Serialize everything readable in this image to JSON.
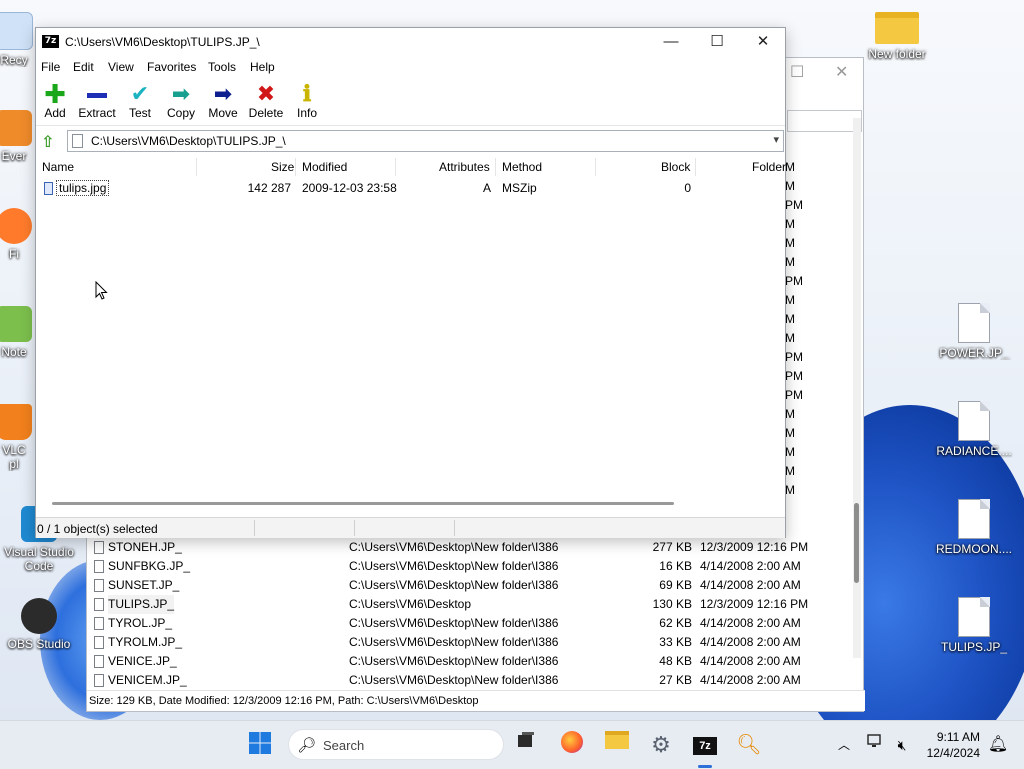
{
  "desktop": {
    "right_icons": [
      {
        "label": "New folder",
        "kind": "folder"
      },
      {
        "label": "POWER.JP_",
        "kind": "file"
      },
      {
        "label": "RADIANCE....",
        "kind": "file"
      },
      {
        "label": "REDMOON....",
        "kind": "file"
      },
      {
        "label": "TULIPS.JP_",
        "kind": "file"
      }
    ],
    "left_icons": [
      {
        "label": "Recy"
      },
      {
        "label": "Ever"
      },
      {
        "label": "Fi"
      },
      {
        "label": "Note"
      },
      {
        "label": "VLC\npl"
      },
      {
        "label": "Visual Studio Code"
      },
      {
        "label": "OBS Studio"
      }
    ]
  },
  "explorer": {
    "right_column": [
      "M",
      "M",
      "PM",
      "M",
      "M",
      "M",
      "PM",
      "M",
      "M",
      "M",
      "PM",
      "PM",
      "PM",
      "M",
      "M",
      "M",
      "M",
      "M"
    ],
    "rows": [
      {
        "name": "STONEH.JP_",
        "path": "C:\\Users\\VM6\\Desktop\\New folder\\I386",
        "size": "277 KB",
        "date": "12/3/2009 12:16 PM"
      },
      {
        "name": "SUNFBKG.JP_",
        "path": "C:\\Users\\VM6\\Desktop\\New folder\\I386",
        "size": "16 KB",
        "date": "4/14/2008 2:00 AM"
      },
      {
        "name": "SUNSET.JP_",
        "path": "C:\\Users\\VM6\\Desktop\\New folder\\I386",
        "size": "69 KB",
        "date": "4/14/2008 2:00 AM"
      },
      {
        "name": "TULIPS.JP_",
        "path": "C:\\Users\\VM6\\Desktop",
        "size": "130 KB",
        "date": "12/3/2009 12:16 PM"
      },
      {
        "name": "TYROL.JP_",
        "path": "C:\\Users\\VM6\\Desktop\\New folder\\I386",
        "size": "62 KB",
        "date": "4/14/2008 2:00 AM"
      },
      {
        "name": "TYROLM.JP_",
        "path": "C:\\Users\\VM6\\Desktop\\New folder\\I386",
        "size": "33 KB",
        "date": "4/14/2008 2:00 AM"
      },
      {
        "name": "VENICE.JP_",
        "path": "C:\\Users\\VM6\\Desktop\\New folder\\I386",
        "size": "48 KB",
        "date": "4/14/2008 2:00 AM"
      },
      {
        "name": "VENICEM.JP_",
        "path": "C:\\Users\\VM6\\Desktop\\New folder\\I386",
        "size": "27 KB",
        "date": "4/14/2008 2:00 AM"
      }
    ],
    "status": "Size: 129 KB, Date Modified: 12/3/2009 12:16 PM, Path: C:\\Users\\VM6\\Desktop"
  },
  "sevenzip": {
    "logo": "7z",
    "title": "C:\\Users\\VM6\\Desktop\\TULIPS.JP_\\",
    "window_buttons": {
      "minimize": "—",
      "maximize": "☐",
      "close": "✕"
    },
    "menu": [
      "File",
      "Edit",
      "View",
      "Favorites",
      "Tools",
      "Help"
    ],
    "toolbar": [
      {
        "label": "Add",
        "icon": "plus-icon",
        "color": "#1aa81a"
      },
      {
        "label": "Extract",
        "icon": "minus-icon",
        "color": "#1f2fb5"
      },
      {
        "label": "Test",
        "icon": "check-icon",
        "color": "#1bb3c0"
      },
      {
        "label": "Copy",
        "icon": "copy-arrow-icon",
        "color": "#17a090"
      },
      {
        "label": "Move",
        "icon": "move-arrow-icon",
        "color": "#0d1f8f"
      },
      {
        "label": "Delete",
        "icon": "delete-x-icon",
        "color": "#d01818"
      },
      {
        "label": "Info",
        "icon": "info-icon",
        "color": "#c9b400"
      }
    ],
    "address": "C:\\Users\\VM6\\Desktop\\TULIPS.JP_\\",
    "columns": [
      "Name",
      "Size",
      "Modified",
      "Attributes",
      "Method",
      "Block",
      "Folders"
    ],
    "columns_visible": [
      "Name",
      "Size",
      "Modified",
      "Attributes",
      "Method",
      "Block",
      "Folder"
    ],
    "files": [
      {
        "name": "tulips.jpg",
        "size": "142 287",
        "modified": "2009-12-03 23:58",
        "attributes": "A",
        "method": "MSZip",
        "block": "0"
      }
    ],
    "status": "0 / 1 object(s) selected"
  },
  "taskbar": {
    "search_placeholder": "Search",
    "time": "9:11 AM",
    "date": "12/4/2024"
  }
}
